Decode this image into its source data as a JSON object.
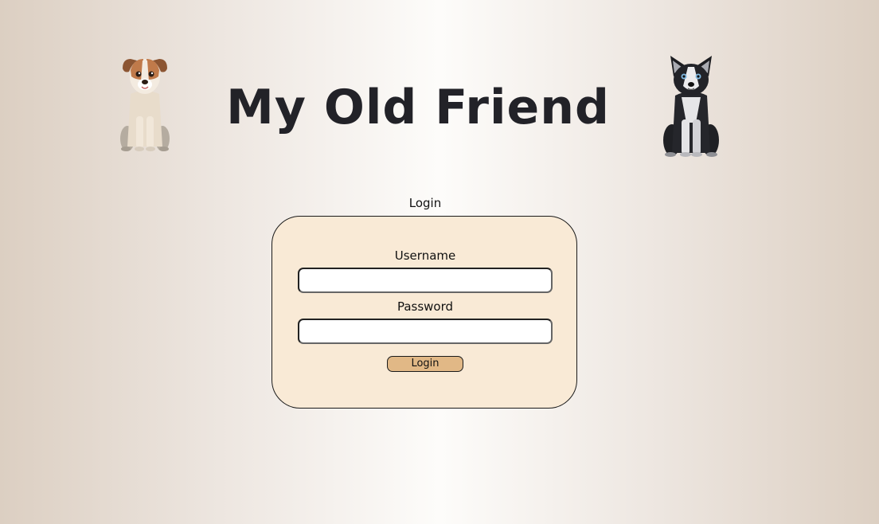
{
  "header": {
    "title": "My Old Friend",
    "left_image": "jack-russell-dog-icon",
    "right_image": "husky-dog-icon"
  },
  "login": {
    "heading": "Login",
    "username_label": "Username",
    "username_value": "",
    "password_label": "Password",
    "password_value": "",
    "button_label": "Login"
  },
  "colors": {
    "card_background": "#f9ead6",
    "button_background": "#e1b886",
    "title_color": "#222228"
  }
}
